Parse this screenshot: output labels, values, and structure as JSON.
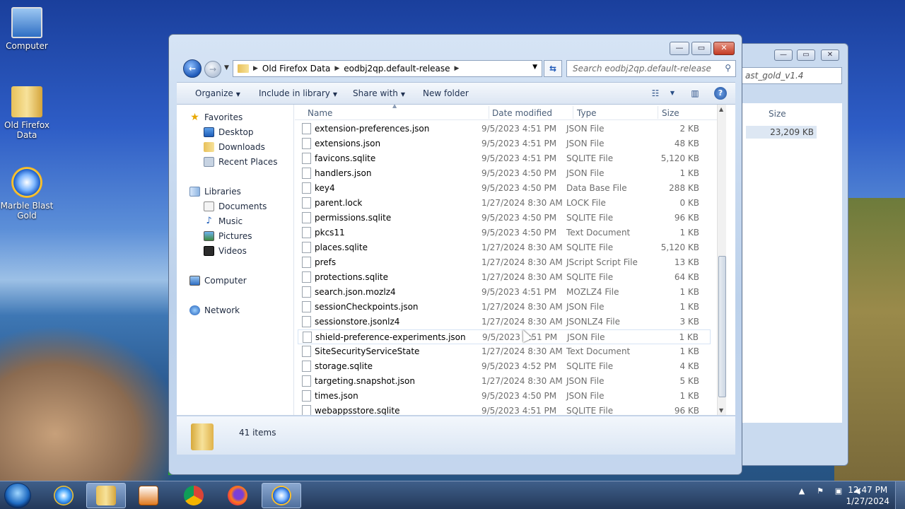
{
  "desktop": {
    "icons": [
      {
        "label": "Computer",
        "icon": "computer-icon"
      },
      {
        "label": "Old Firefox Data",
        "icon": "folder-icon"
      },
      {
        "label": "Marble Blast Gold",
        "icon": "marble-blast-icon"
      }
    ]
  },
  "back_window": {
    "search_placeholder": "ast_gold_v1.4",
    "size_header": "Size",
    "size_value": "23,209 KB"
  },
  "window": {
    "controls": {
      "minimize": "—",
      "maximize": "▭",
      "close": "✕"
    },
    "breadcrumb": [
      "Old Firefox Data",
      "eodbj2qp.default-release"
    ],
    "search_placeholder": "Search eodbj2qp.default-release",
    "toolbar": {
      "organize": "Organize",
      "include_in_library": "Include in library",
      "share_with": "Share with",
      "new_folder": "New folder"
    },
    "sidebar": {
      "favorites": "Favorites",
      "desktop": "Desktop",
      "downloads": "Downloads",
      "recent_places": "Recent Places",
      "libraries": "Libraries",
      "documents": "Documents",
      "music": "Music",
      "pictures": "Pictures",
      "videos": "Videos",
      "computer": "Computer",
      "network": "Network"
    },
    "columns": {
      "name": "Name",
      "date": "Date modified",
      "type": "Type",
      "size": "Size"
    },
    "files": [
      {
        "name": "extension-preferences.json",
        "date": "9/5/2023 4:51 PM",
        "type": "JSON File",
        "size": "2 KB"
      },
      {
        "name": "extensions.json",
        "date": "9/5/2023 4:51 PM",
        "type": "JSON File",
        "size": "48 KB"
      },
      {
        "name": "favicons.sqlite",
        "date": "9/5/2023 4:51 PM",
        "type": "SQLITE File",
        "size": "5,120 KB"
      },
      {
        "name": "handlers.json",
        "date": "9/5/2023 4:50 PM",
        "type": "JSON File",
        "size": "1 KB"
      },
      {
        "name": "key4",
        "date": "9/5/2023 4:50 PM",
        "type": "Data Base File",
        "size": "288 KB"
      },
      {
        "name": "parent.lock",
        "date": "1/27/2024 8:30 AM",
        "type": "LOCK File",
        "size": "0 KB"
      },
      {
        "name": "permissions.sqlite",
        "date": "9/5/2023 4:50 PM",
        "type": "SQLITE File",
        "size": "96 KB"
      },
      {
        "name": "pkcs11",
        "date": "9/5/2023 4:50 PM",
        "type": "Text Document",
        "size": "1 KB"
      },
      {
        "name": "places.sqlite",
        "date": "1/27/2024 8:30 AM",
        "type": "SQLITE File",
        "size": "5,120 KB"
      },
      {
        "name": "prefs",
        "date": "1/27/2024 8:30 AM",
        "type": "JScript Script File",
        "size": "13 KB"
      },
      {
        "name": "protections.sqlite",
        "date": "1/27/2024 8:30 AM",
        "type": "SQLITE File",
        "size": "64 KB"
      },
      {
        "name": "search.json.mozlz4",
        "date": "9/5/2023 4:51 PM",
        "type": "MOZLZ4 File",
        "size": "1 KB"
      },
      {
        "name": "sessionCheckpoints.json",
        "date": "1/27/2024 8:30 AM",
        "type": "JSON File",
        "size": "1 KB"
      },
      {
        "name": "sessionstore.jsonlz4",
        "date": "1/27/2024 8:30 AM",
        "type": "JSONLZ4 File",
        "size": "3 KB"
      },
      {
        "name": "shield-preference-experiments.json",
        "date": "9/5/2023 4:51 PM",
        "type": "JSON File",
        "size": "1 KB"
      },
      {
        "name": "SiteSecurityServiceState",
        "date": "1/27/2024 8:30 AM",
        "type": "Text Document",
        "size": "1 KB"
      },
      {
        "name": "storage.sqlite",
        "date": "9/5/2023 4:52 PM",
        "type": "SQLITE File",
        "size": "4 KB"
      },
      {
        "name": "targeting.snapshot.json",
        "date": "1/27/2024 8:30 AM",
        "type": "JSON File",
        "size": "5 KB"
      },
      {
        "name": "times.json",
        "date": "9/5/2023 4:50 PM",
        "type": "JSON File",
        "size": "1 KB"
      },
      {
        "name": "webappsstore.sqlite",
        "date": "9/5/2023 4:51 PM",
        "type": "SQLITE File",
        "size": "96 KB"
      }
    ],
    "item_count": "41 items"
  },
  "taskbar": {
    "clock_time": "12:47 PM",
    "clock_date": "1/27/2024"
  }
}
